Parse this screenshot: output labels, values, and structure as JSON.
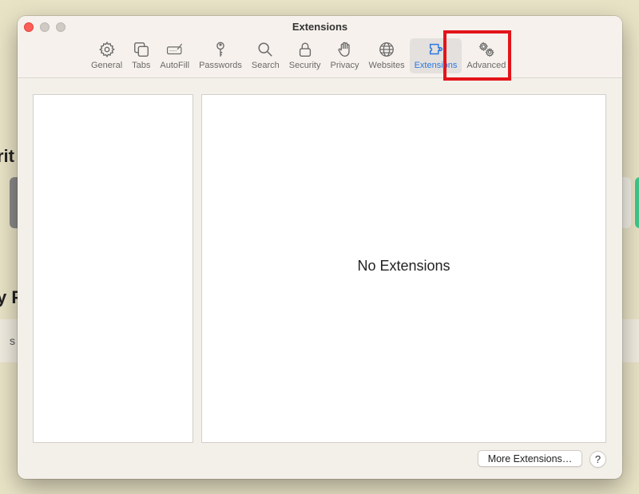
{
  "window": {
    "title": "Extensions"
  },
  "background": {
    "fav_partial": "rit",
    "priv_partial": "y P",
    "bar_partial": "s"
  },
  "tabs": [
    {
      "label": "General",
      "icon": "gear-icon"
    },
    {
      "label": "Tabs",
      "icon": "tabs-icon"
    },
    {
      "label": "AutoFill",
      "icon": "autofill-icon"
    },
    {
      "label": "Passwords",
      "icon": "key-icon"
    },
    {
      "label": "Search",
      "icon": "search-icon"
    },
    {
      "label": "Security",
      "icon": "lock-icon"
    },
    {
      "label": "Privacy",
      "icon": "hand-icon"
    },
    {
      "label": "Websites",
      "icon": "globe-icon"
    },
    {
      "label": "Extensions",
      "icon": "puzzle-icon",
      "active": true
    },
    {
      "label": "Advanced",
      "icon": "gears-icon"
    }
  ],
  "content": {
    "empty_message": "No Extensions"
  },
  "footer": {
    "more_label": "More Extensions…",
    "help_label": "?"
  },
  "colors": {
    "accent": "#2b78e4",
    "highlight": "#e3141b",
    "close": "#fe5f57"
  }
}
